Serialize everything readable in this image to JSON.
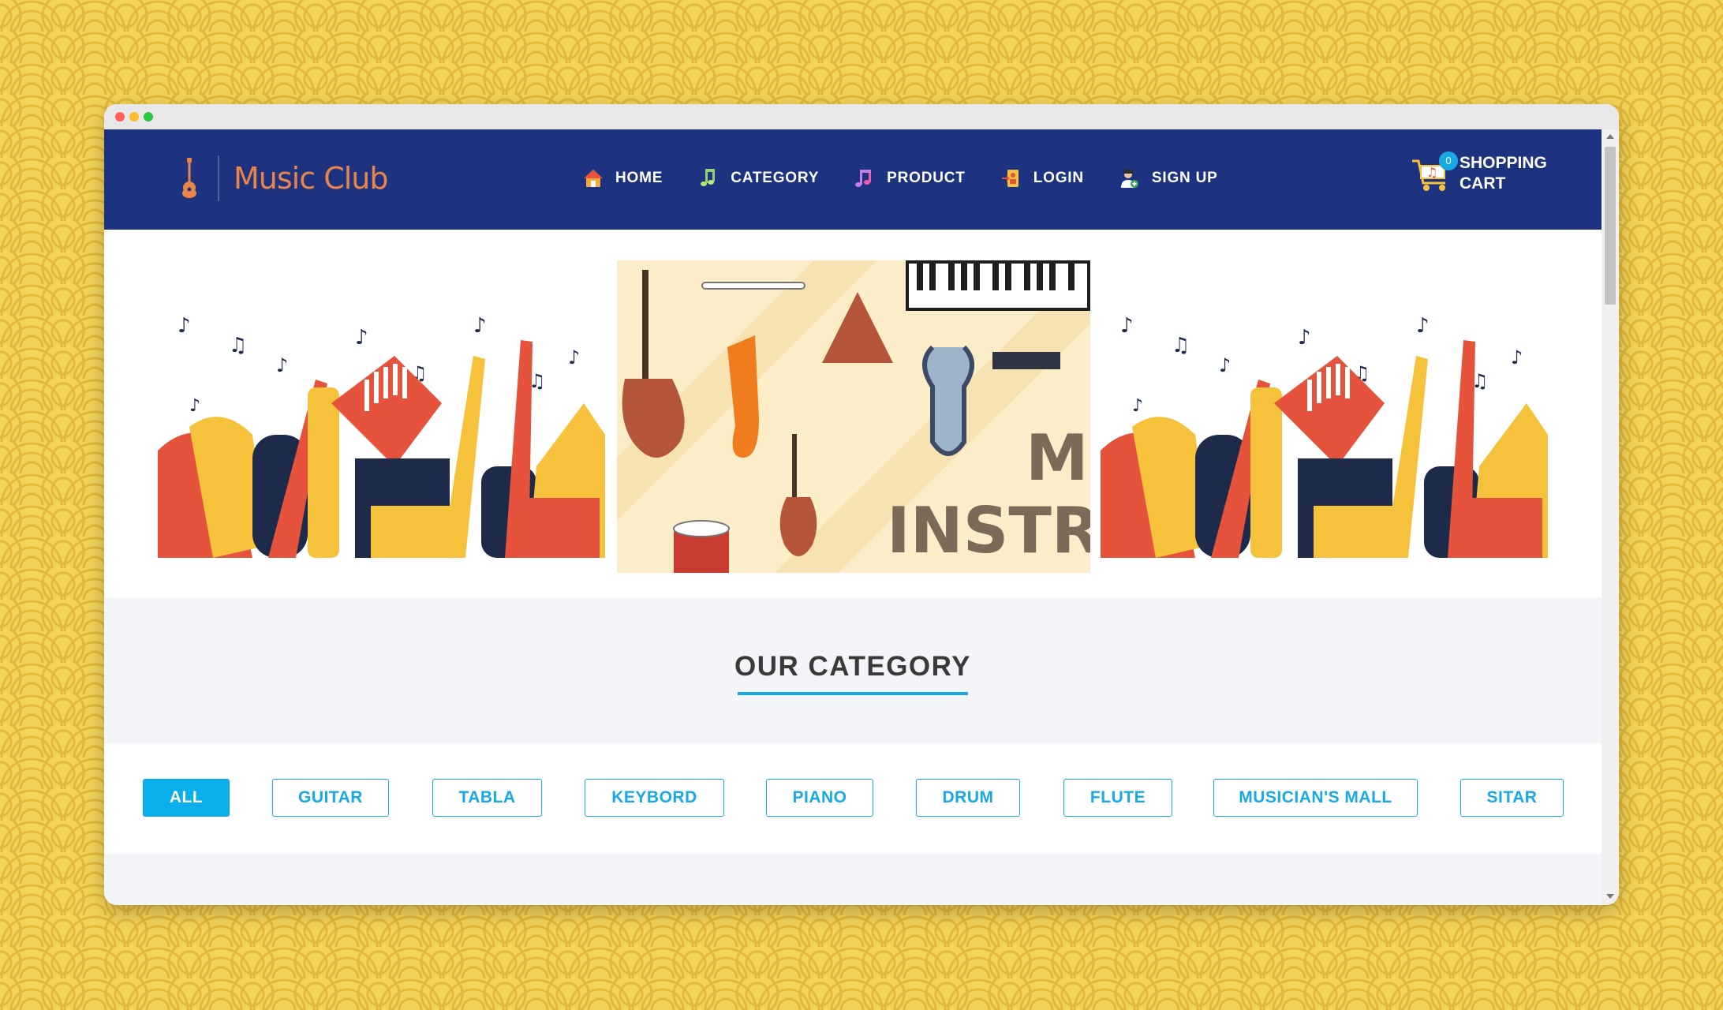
{
  "brand": {
    "name": "Music Club",
    "accent_color": "#e9854a",
    "header_color": "#1e3380"
  },
  "nav": {
    "items": [
      {
        "label": "HOME",
        "icon": "home-icon"
      },
      {
        "label": "CATEGORY",
        "icon": "music-note-icon"
      },
      {
        "label": "PRODUCT",
        "icon": "music-notes-icon"
      },
      {
        "label": "LOGIN",
        "icon": "login-icon"
      },
      {
        "label": "SIGN UP",
        "icon": "user-add-icon"
      }
    ]
  },
  "cart": {
    "count": "0",
    "label_line1": "SHOPPING",
    "label_line2": "CART",
    "icon": "shopping-cart-icon"
  },
  "banner": {
    "center_text_line1": "MU",
    "center_text_line2": "INSTRUME"
  },
  "section": {
    "title": "OUR CATEGORY"
  },
  "filters": {
    "active_color": "#0aaeea",
    "items": [
      "ALL",
      "GUITAR",
      "TABLA",
      "KEYBORD",
      "PIANO",
      "DRUM",
      "FLUTE",
      "MUSICIAN'S MALL",
      "SITAR"
    ]
  }
}
